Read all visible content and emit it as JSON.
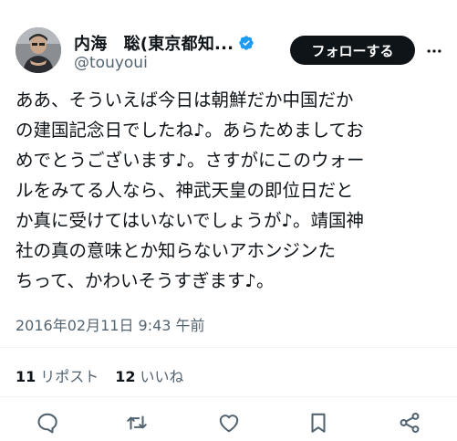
{
  "user": {
    "display_name": "内海　聡(東京都知...",
    "handle": "@touyoui",
    "verified_icon": "verified-badge-icon",
    "avatar_icon": "avatar"
  },
  "follow_button": {
    "label": "フォローする"
  },
  "tweet": {
    "lines": [
      "ああ、そういえば今日は朝鮮だか中国だか",
      "の建国記念日でしたね♪。あらためましてお",
      "めでとうございます♪。さすがにこのウォー",
      "ルをみてる人なら、神武天皇の即位日だと",
      "か真に受けてはいないでしょうが♪。靖国神",
      "社の真の意味とか知らないアホンジンた",
      "ちって、かわいそうすぎます♪。"
    ],
    "timestamp": "2016年02月11日 9:43 午前"
  },
  "stats": {
    "reposts_count": "11",
    "reposts_label": "リポスト",
    "likes_count": "12",
    "likes_label": "いいね"
  },
  "actions": [
    "reply-icon",
    "repost-icon",
    "like-icon",
    "bookmark-icon",
    "share-icon"
  ],
  "colors": {
    "text": "#0f1419",
    "secondary": "#536471",
    "verified": "#1d9bf0",
    "button_bg": "#0f1419",
    "divider": "#eff3f4"
  }
}
